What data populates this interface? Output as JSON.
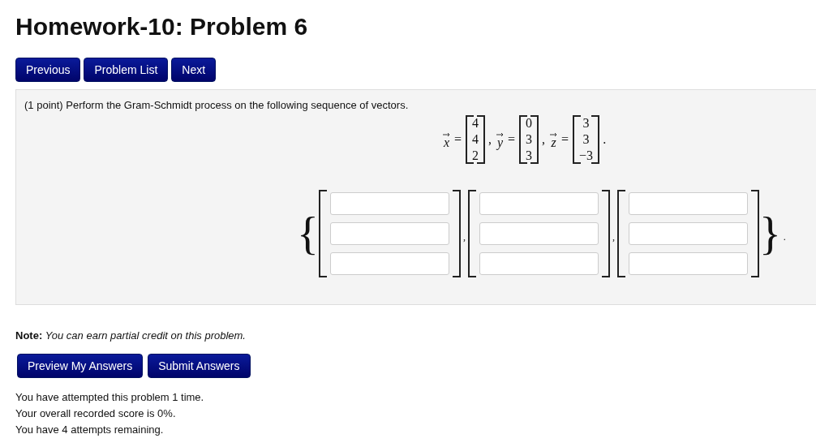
{
  "title": "Homework-10: Problem 6",
  "nav_buttons": [
    "Previous",
    "Problem List",
    "Next"
  ],
  "problem": {
    "statement": "(1 point) Perform the Gram-Schmidt process on the following sequence of vectors.",
    "vectors": [
      {
        "symbol": "x",
        "relation": "=",
        "entries": [
          "4",
          "4",
          "2"
        ],
        "punct": ","
      },
      {
        "symbol": "y",
        "relation": "=",
        "entries": [
          "0",
          "3",
          "3"
        ],
        "punct": ","
      },
      {
        "symbol": "z",
        "relation": "=",
        "entries": [
          "3",
          "3",
          "−3"
        ],
        "punct": "."
      }
    ],
    "answer": {
      "open_brace": "{",
      "close_brace": "}",
      "final_punct": ".",
      "vectors": [
        {
          "fields": [
            {
              "kind": "text-input"
            },
            {
              "kind": "text-input"
            },
            {
              "kind": "text-input"
            }
          ],
          "separator": ","
        },
        {
          "fields": [
            {
              "kind": "text-input"
            },
            {
              "kind": "text-input"
            },
            {
              "kind": "text-input"
            }
          ],
          "separator": ","
        },
        {
          "fields": [
            {
              "kind": "text-input"
            },
            {
              "kind": "text-input"
            },
            {
              "kind": "text-input"
            }
          ]
        }
      ]
    }
  },
  "note": {
    "label": "Note:",
    "text": "You can earn partial credit on this problem."
  },
  "action_buttons": [
    "Preview My Answers",
    "Submit Answers"
  ],
  "messages": [
    "You have attempted this problem 1 time.",
    "Your overall recorded score is 0%.",
    "You have 4 attempts remaining."
  ]
}
